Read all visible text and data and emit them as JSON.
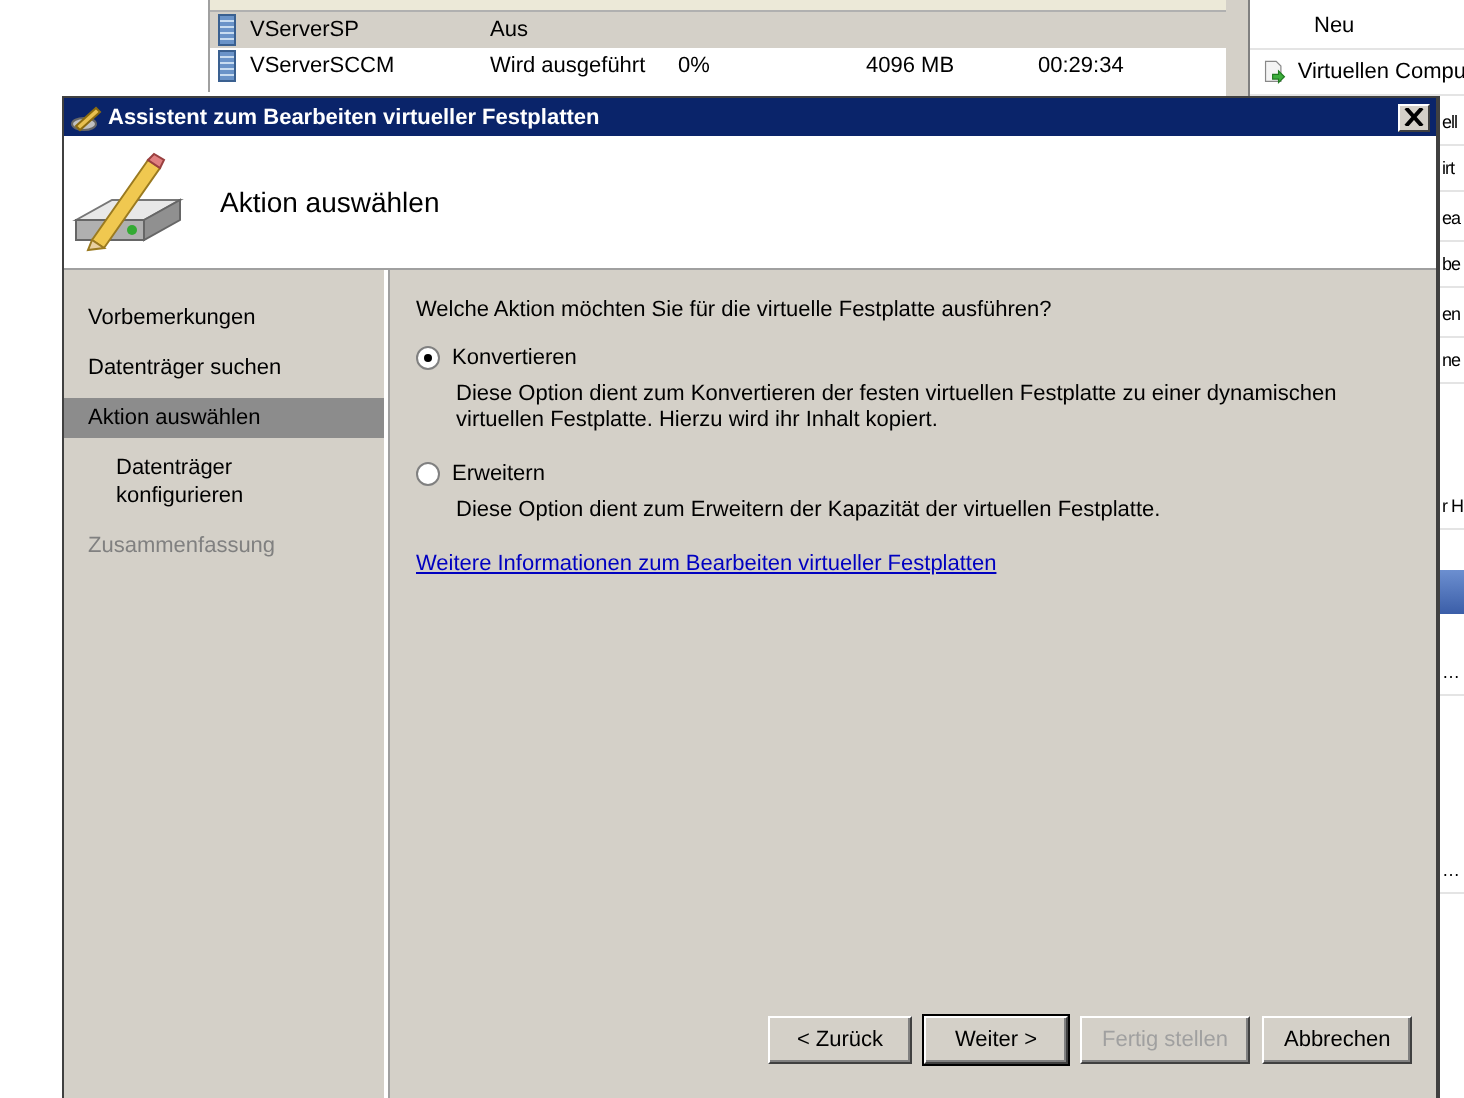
{
  "background_window": {
    "vm_table": {
      "rows": [
        {
          "name": "VServerSP",
          "state": "Aus",
          "selected": true
        },
        {
          "name": "VServerSCCM",
          "state": "Wird ausgeführt",
          "cpu_usage": "0%",
          "memory": "4096 MB",
          "uptime": "00:29:34",
          "selected": false
        }
      ]
    },
    "actions": [
      {
        "kind": "plain",
        "label": "Neu"
      },
      {
        "kind": "import",
        "label": "Virtuellen Compu"
      },
      {
        "kind": "clipped",
        "label": "ell"
      },
      {
        "kind": "clipped",
        "label": "irt"
      },
      {
        "kind": "clipped",
        "label": "ea"
      },
      {
        "kind": "clipped",
        "label": "be"
      },
      {
        "kind": "clipped",
        "label": "en"
      },
      {
        "kind": "clipped",
        "label": "ne"
      },
      {
        "kind": "clipped",
        "label": "r H"
      },
      {
        "kind": "header"
      },
      {
        "kind": "clipped",
        "label": "…"
      },
      {
        "kind": "clipped",
        "label": "…"
      }
    ]
  },
  "dialog": {
    "title": "Assistent zum Bearbeiten virtueller Festplatten",
    "heading": "Aktion auswählen",
    "steps": [
      {
        "label": "Vorbemerkungen",
        "selected": false,
        "disabled": false
      },
      {
        "label": "Datenträger suchen",
        "selected": false,
        "disabled": false
      },
      {
        "label": "Aktion auswählen",
        "selected": true,
        "disabled": false,
        "children": [
          {
            "label": "Datenträger konfigurieren",
            "selected": false,
            "disabled": false
          }
        ]
      },
      {
        "label": "Zusammenfassung",
        "selected": false,
        "disabled": true
      }
    ],
    "question": "Welche Aktion möchten Sie für die virtuelle Festplatte ausführen?",
    "options": [
      {
        "label": "Konvertieren",
        "selected": true,
        "description": "Diese Option dient zum Konvertieren der festen virtuellen Festplatte zu einer dynamischen virtuellen Festplatte. Hierzu wird ihr Inhalt kopiert."
      },
      {
        "label": "Erweitern",
        "selected": false,
        "description": "Diese Option dient zum Erweitern der Kapazität der virtuellen Festplatte."
      }
    ],
    "link": "Weitere Informationen zum Bearbeiten virtueller Festplatten",
    "buttons": [
      {
        "label": "< Zurück",
        "disabled": false,
        "default": false
      },
      {
        "label": "Weiter >",
        "disabled": false,
        "default": true
      },
      {
        "label": "Fertig stellen",
        "disabled": true,
        "default": false
      },
      {
        "label": "Abbrechen",
        "disabled": false,
        "default": false
      }
    ]
  }
}
